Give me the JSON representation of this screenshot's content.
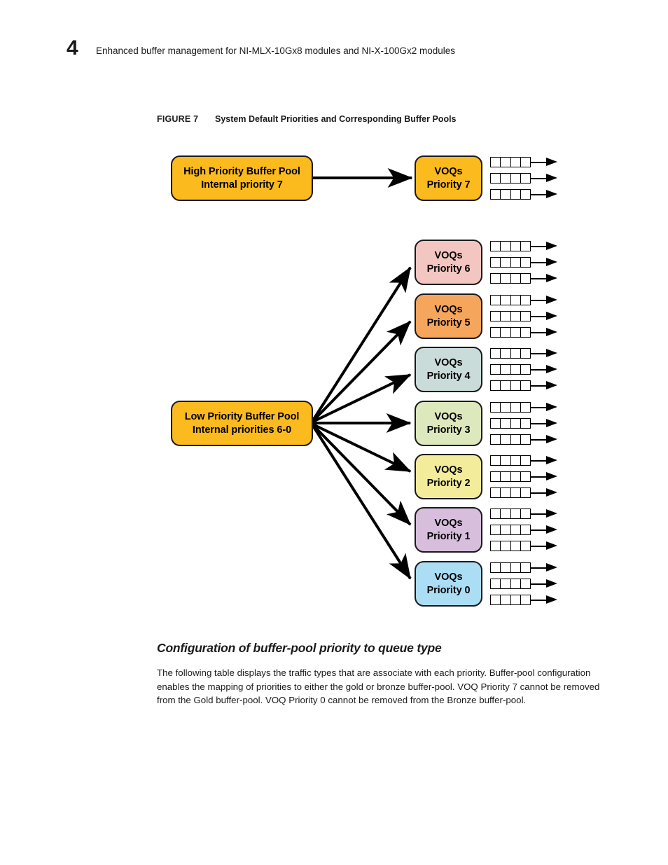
{
  "header": {
    "chapter_number": "4",
    "title": "Enhanced buffer management for NI-MLX-10Gx8 modules and NI-X-100Gx2 modules"
  },
  "figure": {
    "label": "FIGURE 7",
    "title": "System Default Priorities and Corresponding Buffer Pools"
  },
  "diagram": {
    "pools": [
      {
        "id": "high-priority-pool",
        "line1": "High Priority Buffer Pool",
        "line2": "Internal priority 7",
        "color": "#FBBA1D"
      },
      {
        "id": "low-priority-pool",
        "line1": "Low Priority Buffer Pool",
        "line2": "Internal priorities 6-0",
        "color": "#FBBA1D"
      }
    ],
    "voqs": [
      {
        "id": "voq-priority-7",
        "line1": "VOQs",
        "line2": "Priority 7",
        "color": "#FBBA1D",
        "queues": 3,
        "cells": 4
      },
      {
        "id": "voq-priority-6",
        "line1": "VOQs",
        "line2": "Priority 6",
        "color": "#F4C6C1",
        "queues": 3,
        "cells": 4
      },
      {
        "id": "voq-priority-5",
        "line1": "VOQs",
        "line2": "Priority 5",
        "color": "#F5A65C",
        "queues": 3,
        "cells": 4
      },
      {
        "id": "voq-priority-4",
        "line1": "VOQs",
        "line2": "Priority 4",
        "color": "#CADCD9",
        "queues": 3,
        "cells": 4
      },
      {
        "id": "voq-priority-3",
        "line1": "VOQs",
        "line2": "Priority 3",
        "color": "#DDE8BC",
        "queues": 3,
        "cells": 4
      },
      {
        "id": "voq-priority-2",
        "line1": "VOQs",
        "line2": "Priority 2",
        "color": "#F2EC9B",
        "queues": 3,
        "cells": 4
      },
      {
        "id": "voq-priority-1",
        "line1": "VOQs",
        "line2": "Priority 1",
        "color": "#D7BEDD",
        "queues": 3,
        "cells": 4
      },
      {
        "id": "voq-priority-0",
        "line1": "VOQs",
        "line2": "Priority 0",
        "color": "#ABDDF5",
        "queues": 3,
        "cells": 4
      }
    ]
  },
  "section": {
    "heading": "Configuration of buffer-pool priority to queue type",
    "paragraph": "The following table displays the traffic types that are associate with each priority. Buffer-pool configuration enables the mapping of priorities to either the gold or bronze buffer-pool. VOQ Priority 7 cannot be removed from the Gold buffer-pool. VOQ Priority 0 cannot be removed from the Bronze buffer-pool."
  }
}
